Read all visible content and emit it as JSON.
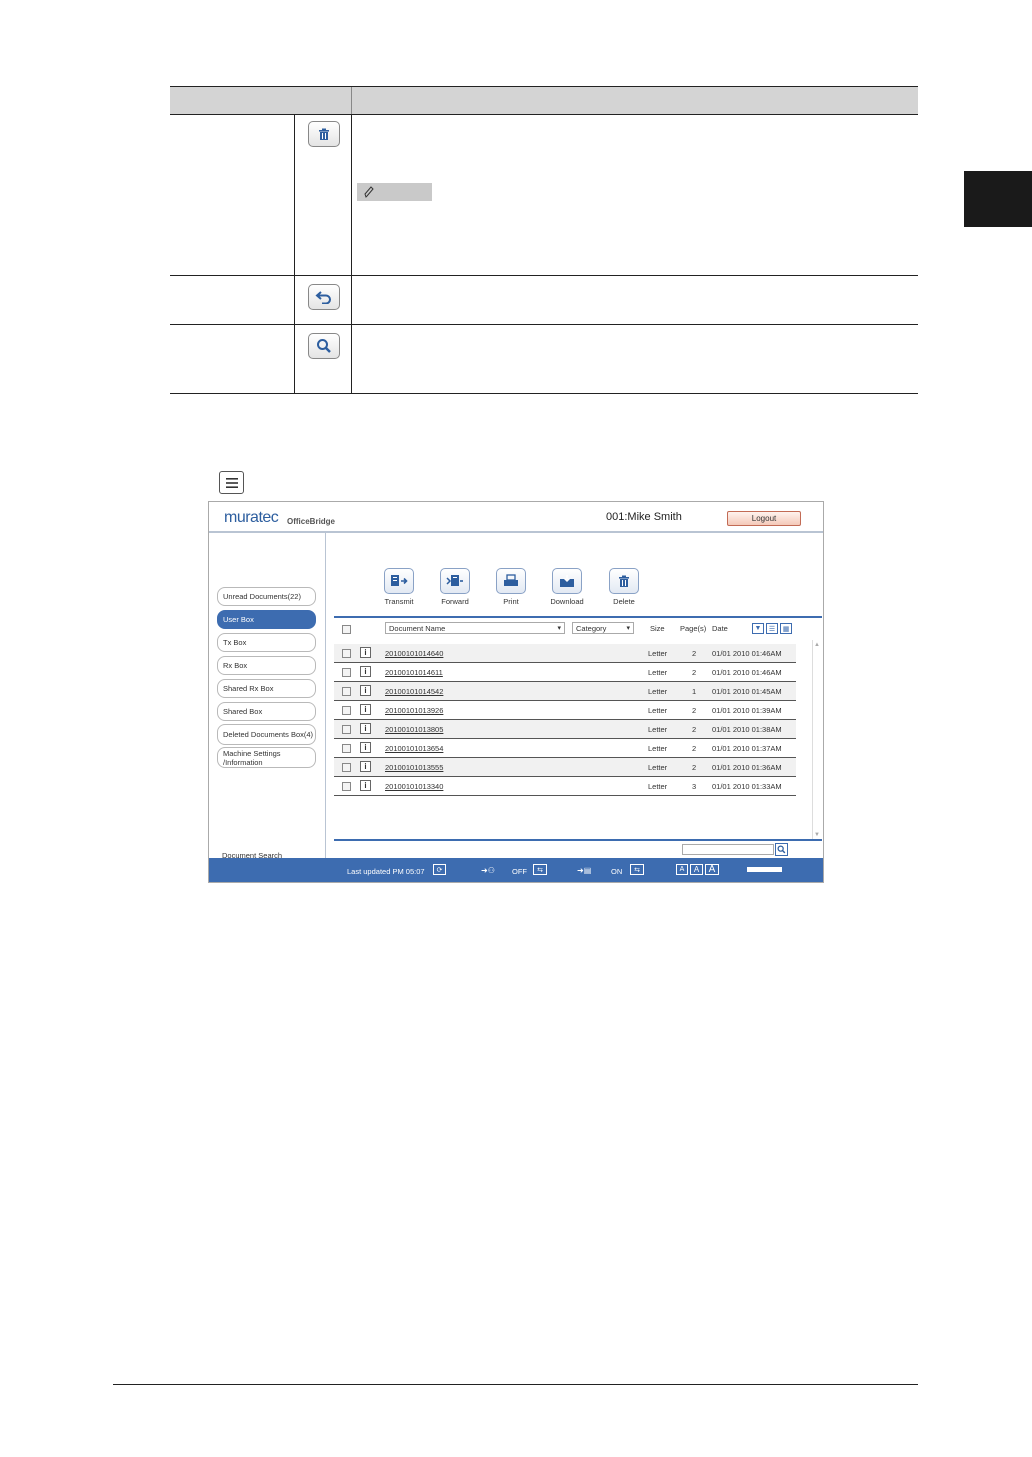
{
  "reference_table": {
    "header": [
      "",
      ""
    ],
    "rows": [
      {
        "icon": "trash-icon",
        "has_memo_bar": true
      },
      {
        "icon": "back-arrow-icon",
        "has_memo_bar": false
      },
      {
        "icon": "magnifier-icon",
        "has_memo_bar": false
      }
    ]
  },
  "screenshot": {
    "logo": "muratec",
    "logo_sub": "OfficeBridge",
    "user": "001:Mike Smith",
    "logout": "Logout",
    "sidebar": [
      {
        "label": "Unread Documents(22)",
        "active": false
      },
      {
        "label": "User Box",
        "active": true
      },
      {
        "label": "Tx Box",
        "active": false
      },
      {
        "label": "Rx Box",
        "active": false
      },
      {
        "label": "Shared Rx Box",
        "active": false
      },
      {
        "label": "Shared Box",
        "active": false
      },
      {
        "label": "Deleted Documents Box(4)",
        "active": false
      },
      {
        "label": "Machine Settings /Information",
        "active": false
      }
    ],
    "document_search": "Document Search",
    "toolbar": [
      "Transmit",
      "Forward",
      "Print",
      "Download",
      "Delete"
    ],
    "columns": {
      "document_name": "Document Name",
      "category": "Category",
      "size": "Size",
      "pages": "Page(s)",
      "date": "Date"
    },
    "documents": [
      {
        "name": "20100101014640",
        "size": "Letter",
        "pages": "2",
        "date": "01/01 2010 01:46AM"
      },
      {
        "name": "20100101014611",
        "size": "Letter",
        "pages": "2",
        "date": "01/01 2010 01:46AM"
      },
      {
        "name": "20100101014542",
        "size": "Letter",
        "pages": "1",
        "date": "01/01 2010 01:45AM"
      },
      {
        "name": "20100101013926",
        "size": "Letter",
        "pages": "2",
        "date": "01/01 2010 01:39AM"
      },
      {
        "name": "20100101013805",
        "size": "Letter",
        "pages": "2",
        "date": "01/01 2010 01:38AM"
      },
      {
        "name": "20100101013654",
        "size": "Letter",
        "pages": "2",
        "date": "01/01 2010 01:37AM"
      },
      {
        "name": "20100101013555",
        "size": "Letter",
        "pages": "2",
        "date": "01/01 2010 01:36AM"
      },
      {
        "name": "20100101013340",
        "size": "Letter",
        "pages": "3",
        "date": "01/01 2010 01:33AM"
      }
    ],
    "footer": {
      "last_updated": "Last updated PM 05:07",
      "off": "OFF",
      "on": "ON",
      "font_sizes": [
        "A",
        "A",
        "A"
      ]
    },
    "colors": {
      "accent": "#3d6cb0",
      "logout_border": "#c26b55"
    }
  }
}
